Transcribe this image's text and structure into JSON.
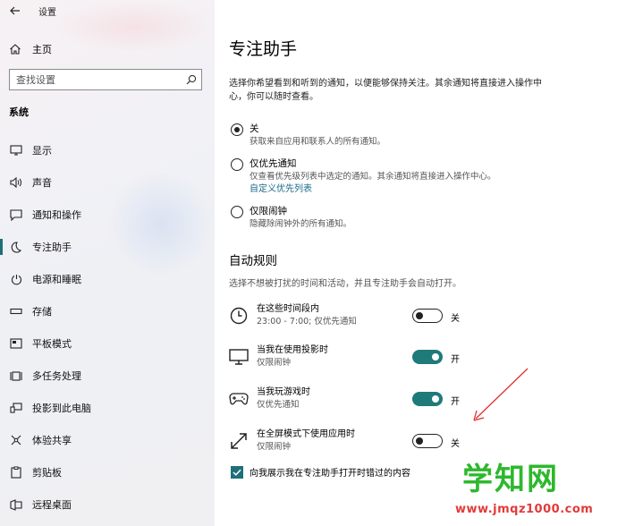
{
  "window": {
    "title": "设置"
  },
  "sidebar": {
    "home_label": "主页",
    "search_placeholder": "查找设置",
    "section_label": "系统",
    "items": [
      {
        "label": "显示",
        "icon": "monitor-icon"
      },
      {
        "label": "声音",
        "icon": "speaker-icon"
      },
      {
        "label": "通知和操作",
        "icon": "notification-icon"
      },
      {
        "label": "专注助手",
        "icon": "moon-icon",
        "active": true
      },
      {
        "label": "电源和睡眠",
        "icon": "power-icon"
      },
      {
        "label": "存储",
        "icon": "storage-icon"
      },
      {
        "label": "平板模式",
        "icon": "tablet-icon"
      },
      {
        "label": "多任务处理",
        "icon": "multitask-icon"
      },
      {
        "label": "投影到此电脑",
        "icon": "project-icon"
      },
      {
        "label": "体验共享",
        "icon": "share-icon"
      },
      {
        "label": "剪贴板",
        "icon": "clipboard-icon"
      },
      {
        "label": "远程桌面",
        "icon": "remote-desktop-icon"
      }
    ]
  },
  "main": {
    "title": "专注助手",
    "intro": "选择你希望看到和听到的通知，以便能够保持关注。其余通知将直接进入操作中心，你可以随时查看。",
    "options": [
      {
        "title": "关",
        "desc": "获取来自应用和联系人的所有通知。",
        "checked": true
      },
      {
        "title": "仅优先通知",
        "desc": "仅查看优先级列表中选定的通知。其余通知将直接进入操作中心。",
        "link": "自定义优先列表",
        "checked": false
      },
      {
        "title": "仅限闹钟",
        "desc": "隐藏除闹钟外的所有通知。",
        "checked": false
      }
    ],
    "auto_rules": {
      "title": "自动规则",
      "desc": "选择不想被打扰的时间和活动，并且专注助手会自动打开。",
      "rules": [
        {
          "title": "在这些时间段内",
          "sub": "23:00 - 7:00; 仅优先通知",
          "state": "关",
          "on": false,
          "icon": "clock-icon"
        },
        {
          "title": "当我在使用投影时",
          "sub": "仅限闹钟",
          "state": "开",
          "on": true,
          "icon": "monitor-icon"
        },
        {
          "title": "当我玩游戏时",
          "sub": "仅优先通知",
          "state": "开",
          "on": true,
          "icon": "gamepad-icon"
        },
        {
          "title": "在全屏模式下使用应用时",
          "sub": "仅限闹钟",
          "state": "关",
          "on": false,
          "icon": "fullscreen-icon"
        }
      ]
    },
    "checkbox_label": "向我展示我在专注助手打开时错过的内容",
    "checkbox_checked": true
  },
  "watermark": {
    "text": "学知网",
    "url": "www.jmqz1000.com"
  },
  "colors": {
    "accent": "#1f6f7a",
    "watermark_green": "#2db82d",
    "watermark_red": "#e23a3a",
    "annotation": "#e03030"
  }
}
